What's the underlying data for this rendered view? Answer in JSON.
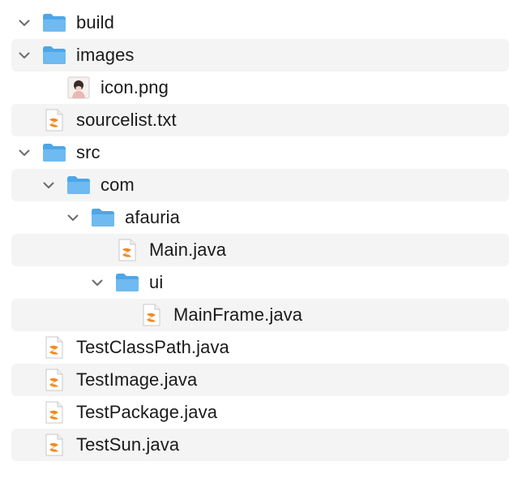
{
  "colors": {
    "folder": "#4da6e8",
    "folder_tab": "#6fbaf0",
    "chevron": "#6b6b6b",
    "swift_orange": "#f08a24",
    "row_alt": "#f4f4f4",
    "text": "#1a1a1a"
  },
  "tree": {
    "items": [
      {
        "label": "build",
        "type": "folder",
        "expanded": true,
        "depth": 0
      },
      {
        "label": "images",
        "type": "folder",
        "expanded": true,
        "depth": 0
      },
      {
        "label": "icon.png",
        "type": "image",
        "depth": 1
      },
      {
        "label": "sourcelist.txt",
        "type": "file",
        "depth": 0
      },
      {
        "label": "src",
        "type": "folder",
        "expanded": true,
        "depth": 0
      },
      {
        "label": "com",
        "type": "folder",
        "expanded": true,
        "depth": 1
      },
      {
        "label": "afauria",
        "type": "folder",
        "expanded": true,
        "depth": 2
      },
      {
        "label": "Main.java",
        "type": "file",
        "depth": 3
      },
      {
        "label": "ui",
        "type": "folder",
        "expanded": true,
        "depth": 3
      },
      {
        "label": "MainFrame.java",
        "type": "file",
        "depth": 4
      },
      {
        "label": "TestClassPath.java",
        "type": "file",
        "depth": 0
      },
      {
        "label": "TestImage.java",
        "type": "file",
        "depth": 0
      },
      {
        "label": "TestPackage.java",
        "type": "file",
        "depth": 0
      },
      {
        "label": "TestSun.java",
        "type": "file",
        "depth": 0
      }
    ]
  }
}
